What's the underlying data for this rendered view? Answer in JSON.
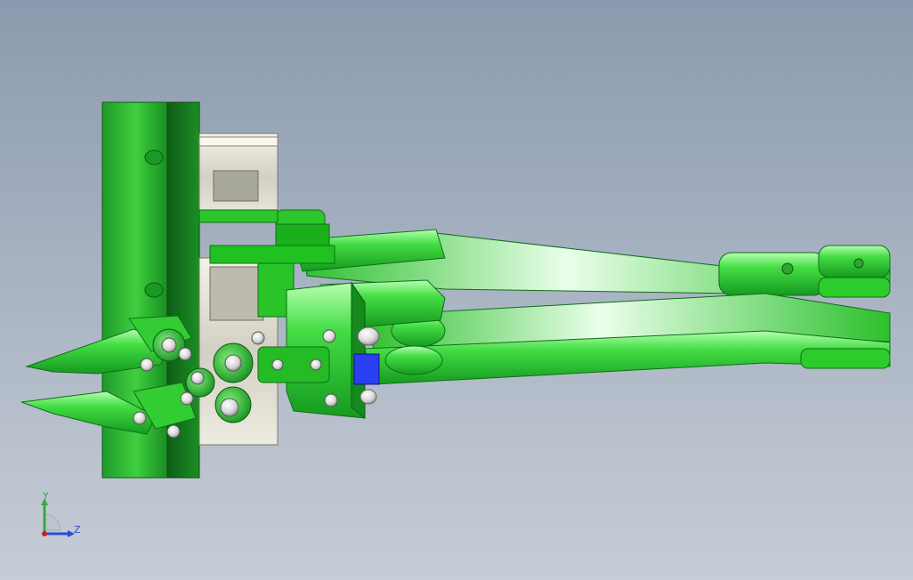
{
  "viewport": {
    "background_top": "#8b9aae",
    "background_bottom": "#c7cdd6"
  },
  "model": {
    "part_color": "#22cc22",
    "part_dark": "#0f7a1a",
    "part_highlight": "#b8ffb0",
    "motor_color": "#e8e6d8",
    "fastener_color": "#f0f0f0",
    "accent_part_color": "#2a3ff0"
  },
  "triad": {
    "y_label": "Y",
    "z_label": "Z",
    "y_color": "#3aa64a",
    "z_color": "#2b4fd1",
    "origin_color": "#cc2222"
  }
}
